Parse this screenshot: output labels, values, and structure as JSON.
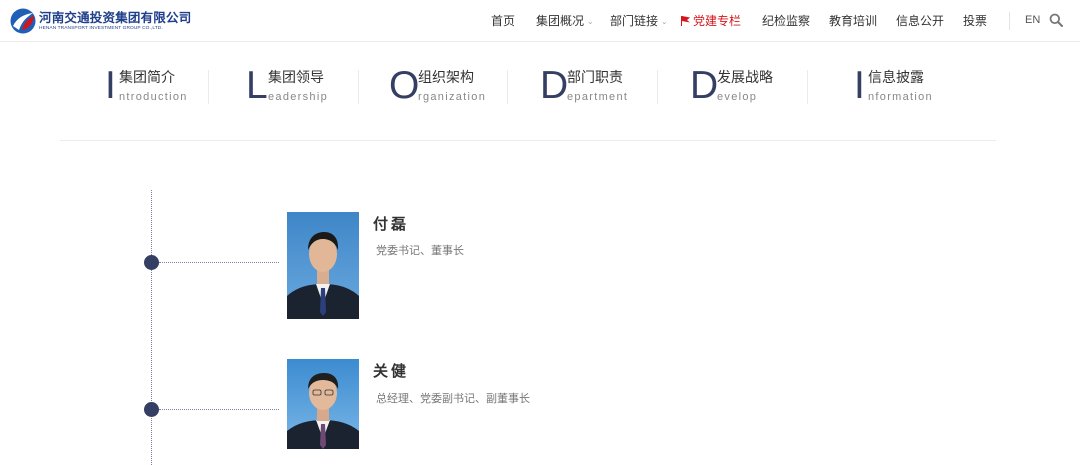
{
  "logo": {
    "name_cn": "河南交通投资集团有限公司",
    "name_en": "HENAN TRANSPORT INVESTMENT GROUP CO.,LTD."
  },
  "nav": {
    "items": [
      {
        "label": "首页"
      },
      {
        "label": "集团概况",
        "dropdown": true
      },
      {
        "label": "部门链接",
        "dropdown": true
      },
      {
        "label": "党建专栏",
        "active": true,
        "icon": "flag-icon"
      },
      {
        "label": "纪检监察"
      },
      {
        "label": "教育培训"
      },
      {
        "label": "信息公开"
      },
      {
        "label": "投票"
      }
    ],
    "lang": "EN",
    "accent": "#d4161c"
  },
  "subnav": [
    {
      "letter": "I",
      "cn": "集团简介",
      "en": "ntroduction"
    },
    {
      "letter": "L",
      "cn": "集团领导",
      "en": "eadership"
    },
    {
      "letter": "O",
      "cn": "组织架构",
      "en": "rganization"
    },
    {
      "letter": "D",
      "cn": "部门职责",
      "en": "epartment"
    },
    {
      "letter": "D",
      "cn": "发展战略",
      "en": "evelop"
    },
    {
      "letter": "I",
      "cn": "信息披露",
      "en": "nformation"
    }
  ],
  "leaders": [
    {
      "name": "付磊",
      "title": "党委书记、董事长"
    },
    {
      "name": "关健",
      "title": "总经理、党委副书记、副董事长"
    }
  ],
  "colors": {
    "brand_dark": "#353f63",
    "logo_blue": "#1f3f8a"
  }
}
